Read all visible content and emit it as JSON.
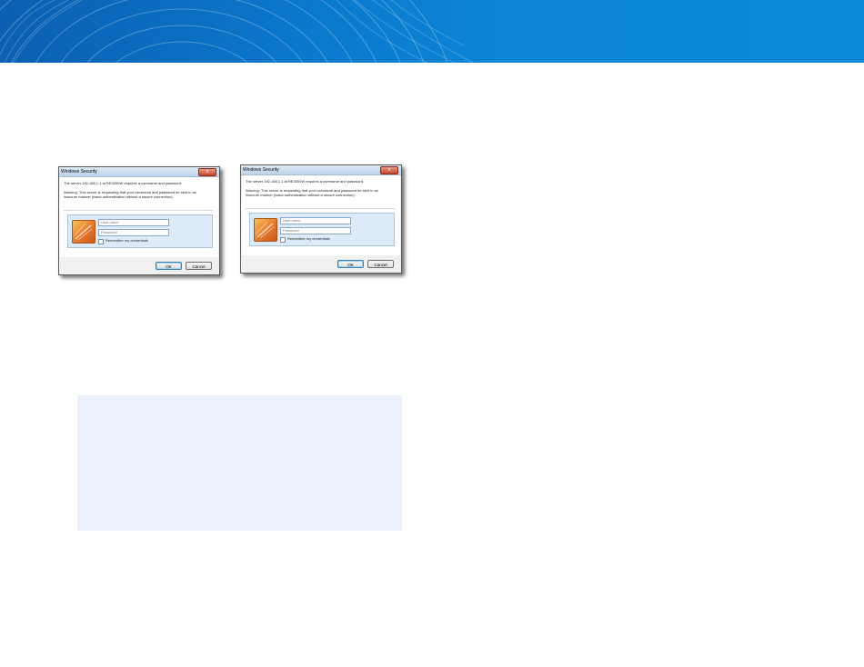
{
  "dialog_left": {
    "title": "Windows Security",
    "close_label": "x",
    "message": "The server 192.168.1.1 at RE3000W requires a username and password.",
    "warning": "Warning: This server is requesting that your username and password be sent in an insecure manner (basic authentication without a secure connection).",
    "username_placeholder": "User name",
    "password_placeholder": "Password",
    "remember_label": "Remember my credentials",
    "ok_label": "OK",
    "cancel_label": "Cancel"
  },
  "dialog_right": {
    "title": "Windows Security",
    "close_label": "x",
    "message": "The server 192.168.1.1 at RE3000W requires a username and password.",
    "warning": "Warning: This server is requesting that your username and password be sent in an insecure manner (basic authentication without a secure connection).",
    "username_placeholder": "User name",
    "password_placeholder": "Password",
    "remember_label": "Remember my credentials",
    "ok_label": "OK",
    "cancel_label": "Cancel"
  },
  "colors": {
    "banner": "#0b78cc",
    "note_box": "#eaf1fa",
    "credential_icon": "#e9762a"
  },
  "icons": {
    "close": "close-icon",
    "credential": "credential-key-icon",
    "banner": "wave-lines-decoration"
  }
}
